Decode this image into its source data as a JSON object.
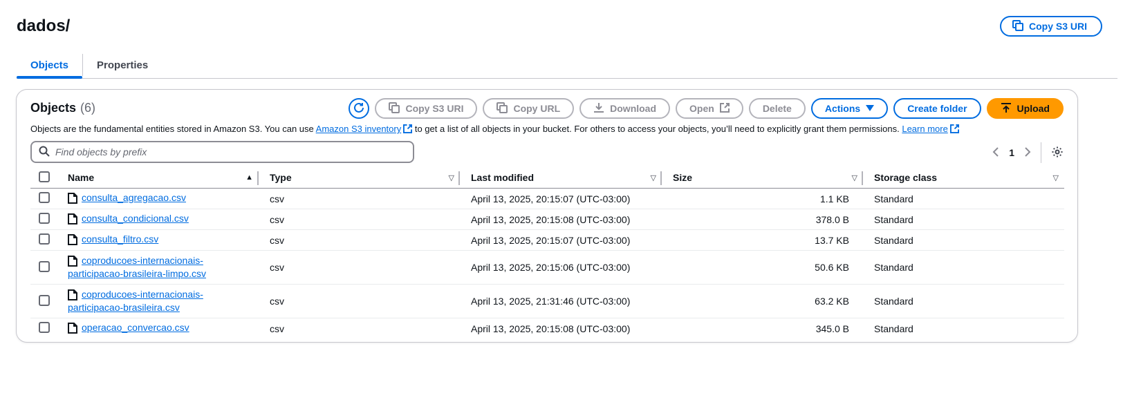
{
  "page": {
    "title": "dados/",
    "copy_uri_label": "Copy S3 URI"
  },
  "tabs": [
    {
      "label": "Objects",
      "active": true
    },
    {
      "label": "Properties",
      "active": false
    }
  ],
  "panel": {
    "title": "Objects",
    "count": "(6)",
    "toolbar": {
      "copy_uri": "Copy S3 URI",
      "copy_url": "Copy URL",
      "download": "Download",
      "open": "Open",
      "delete": "Delete",
      "actions": "Actions",
      "create_folder": "Create folder",
      "upload": "Upload"
    },
    "description": {
      "part1": "Objects are the fundamental entities stored in Amazon S3. You can use ",
      "link1": "Amazon S3 inventory",
      "part2": " to get a list of all objects in your bucket. For others to access your objects, you’ll need to explicitly grant them permissions. ",
      "link2": "Learn more"
    },
    "search": {
      "placeholder": "Find objects by prefix",
      "value": ""
    },
    "pager": {
      "current_page": "1"
    },
    "columns": {
      "name": "Name",
      "type": "Type",
      "last_modified": "Last modified",
      "size": "Size",
      "storage_class": "Storage class"
    },
    "rows": [
      {
        "name_line1": "consulta_agregacao.csv",
        "name_line2": "",
        "type": "csv",
        "last_modified": "April 13, 2025, 20:15:07 (UTC-03:00)",
        "size": "1.1 KB",
        "storage_class": "Standard"
      },
      {
        "name_line1": "consulta_condicional.csv",
        "name_line2": "",
        "type": "csv",
        "last_modified": "April 13, 2025, 20:15:08 (UTC-03:00)",
        "size": "378.0 B",
        "storage_class": "Standard"
      },
      {
        "name_line1": "consulta_filtro.csv",
        "name_line2": "",
        "type": "csv",
        "last_modified": "April 13, 2025, 20:15:07 (UTC-03:00)",
        "size": "13.7 KB",
        "storage_class": "Standard"
      },
      {
        "name_line1": "coproducoes-internacionais-",
        "name_line2": "participacao-brasileira-limpo.csv",
        "type": "csv",
        "last_modified": "April 13, 2025, 20:15:06 (UTC-03:00)",
        "size": "50.6 KB",
        "storage_class": "Standard"
      },
      {
        "name_line1": "coproducoes-internacionais-",
        "name_line2": "participacao-brasileira.csv",
        "type": "csv",
        "last_modified": "April 13, 2025, 21:31:46 (UTC-03:00)",
        "size": "63.2 KB",
        "storage_class": "Standard"
      },
      {
        "name_line1": "operacao_convercao.csv",
        "name_line2": "",
        "type": "csv",
        "last_modified": "April 13, 2025, 20:15:08 (UTC-03:00)",
        "size": "345.0 B",
        "storage_class": "Standard"
      }
    ]
  },
  "colors": {
    "link": "#006ce0",
    "upload": "#ff9900",
    "border": "#c6c6cd"
  },
  "icons": {
    "copy": "copy-icon",
    "refresh": "refresh-icon",
    "download": "download-icon",
    "external": "external-link-icon",
    "caret": "caret-down-icon",
    "upload": "upload-icon",
    "search": "search-icon",
    "file": "file-icon",
    "settings": "gear-icon"
  }
}
